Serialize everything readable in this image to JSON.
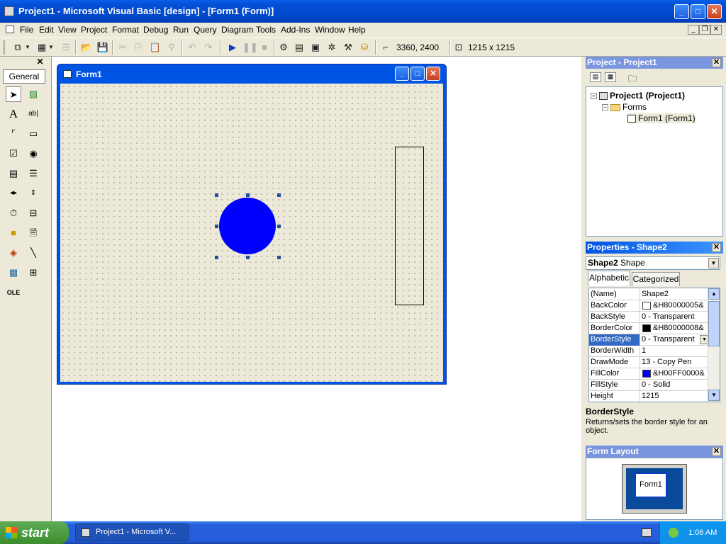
{
  "window": {
    "title": "Project1 - Microsoft Visual Basic [design] - [Form1 (Form)]",
    "controls": {
      "minimize": "_",
      "maximize": "□",
      "close": "✕"
    }
  },
  "menubar": {
    "items": [
      "File",
      "Edit",
      "View",
      "Project",
      "Format",
      "Debug",
      "Run",
      "Query",
      "Diagram",
      "Tools",
      "Add-Ins",
      "Window",
      "Help"
    ]
  },
  "toolbar": {
    "position": "3360, 2400",
    "size": "1215 x 1215"
  },
  "toolbox": {
    "tab_label": "General",
    "close": "✕"
  },
  "form": {
    "title": "Form1",
    "circle_fill": "#0000ff"
  },
  "project_panel": {
    "title": "Project - Project1",
    "close": "✕",
    "root": "Project1 (Project1)",
    "folder": "Forms",
    "item": "Form1 (Form1)"
  },
  "properties_panel": {
    "title": "Properties - Shape2",
    "close": "✕",
    "object_name": "Shape2",
    "object_type": "Shape",
    "tabs": [
      "Alphabetic",
      "Categorized"
    ],
    "rows": [
      {
        "name": "(Name)",
        "value": "Shape2"
      },
      {
        "name": "BackColor",
        "value": "&H80000005&",
        "swatch": "#ffffff"
      },
      {
        "name": "BackStyle",
        "value": "0 - Transparent"
      },
      {
        "name": "BorderColor",
        "value": "&H80000008&",
        "swatch": "#000000"
      },
      {
        "name": "BorderStyle",
        "value": "0 - Transparent"
      },
      {
        "name": "BorderWidth",
        "value": "1"
      },
      {
        "name": "DrawMode",
        "value": "13 - Copy Pen"
      },
      {
        "name": "FillColor",
        "value": "&H00FF0000&",
        "swatch": "#0000ff"
      },
      {
        "name": "FillStyle",
        "value": "0 - Solid"
      },
      {
        "name": "Height",
        "value": "1215"
      }
    ],
    "selected_row": "BorderStyle",
    "description_title": "BorderStyle",
    "description_text": "Returns/sets the border style for an object."
  },
  "layout_panel": {
    "title": "Form Layout",
    "close": "✕",
    "preview_label": "Form1"
  },
  "taskbar": {
    "start": "start",
    "task": "Project1 - Microsoft V...",
    "clock": "1:06 AM"
  }
}
